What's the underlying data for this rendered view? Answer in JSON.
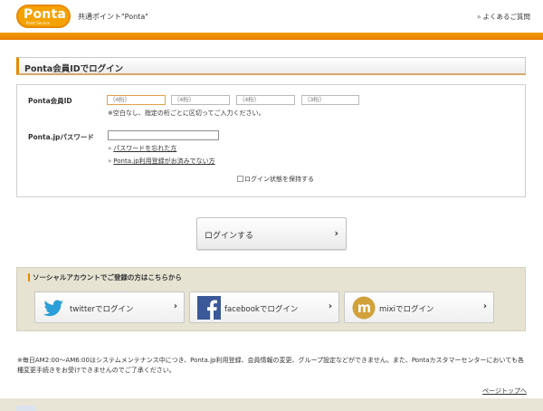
{
  "header": {
    "logo_text": "Ponta",
    "logo_sub": "Point Service",
    "tagline": "共通ポイント\"Ponta\"",
    "faq_link": "よくあるご質問"
  },
  "login": {
    "title": "Ponta会員IDでログイン",
    "id_label": "Ponta会員ID",
    "id_fields": [
      {
        "placeholder": "（4桁）"
      },
      {
        "placeholder": "（4桁）"
      },
      {
        "placeholder": "（4桁）"
      },
      {
        "placeholder": "（3桁）"
      }
    ],
    "id_note": "※空白なし、指定の桁ごとに区切ってご入力ください。",
    "pw_label": "Ponta.jpパスワード",
    "forgot_link": "パスワードを忘れた方",
    "register_link": "Ponta.jp利用登録がお済みでない方",
    "remember_label": "ログイン状態を保持する",
    "login_button": "ログインする"
  },
  "social": {
    "title": "ソーシャルアカウントでご登録の方はこちらから",
    "buttons": [
      {
        "label": "twitterでログイン",
        "icon": "twitter-bird-icon",
        "color": "#2a9fd8"
      },
      {
        "label": "facebookでログイン",
        "icon": "facebook-f-icon",
        "color": "#3b5998"
      },
      {
        "label": "mixiでログイン",
        "icon": "mixi-icon",
        "color": "#d1a13a"
      }
    ]
  },
  "footer": {
    "note": "※毎日AM2:00～AM6:00はシステムメンテナンス中につき、Ponta.jp利用登録、会員情報の変更、グループ設定などができません。また、Pontaカスタマーセンターにおいても各種変更手続きをお受けできませんのでご了承ください。",
    "page_top": "ページトップへ"
  },
  "colors": {
    "accent": "#e88a00",
    "social_bg": "#e6e3d2"
  }
}
